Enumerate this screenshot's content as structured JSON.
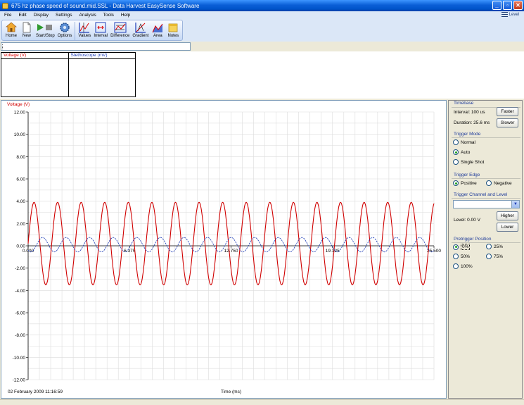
{
  "window": {
    "title": "675 hz phase speed of sound.mid.SSL - Data Harvest EasySense Software",
    "minimize": "_",
    "maximize": "▫",
    "close": "✕"
  },
  "menu": [
    "File",
    "Edit",
    "Display",
    "Settings",
    "Analysis",
    "Tools",
    "Help"
  ],
  "level_button": {
    "label": "Level",
    "icon": "menu-bars-icon"
  },
  "toolbar": [
    {
      "label": "Home",
      "icon": "home-icon"
    },
    {
      "label": "New",
      "icon": "new-document-icon"
    },
    {
      "label": "Start/Stop",
      "icon": "play-stop-icon"
    },
    {
      "label": "Options",
      "icon": "gear-icon"
    },
    {
      "label": "Values",
      "icon": "values-icon"
    },
    {
      "label": "Interval",
      "icon": "interval-icon"
    },
    {
      "label": "Difference",
      "icon": "difference-icon"
    },
    {
      "label": "Gradient",
      "icon": "gradient-icon"
    },
    {
      "label": "Area",
      "icon": "area-icon"
    },
    {
      "label": "Notes",
      "icon": "notes-icon"
    }
  ],
  "meters": [
    {
      "label": "Voltage (V)",
      "color": "#d00000"
    },
    {
      "label": "Stethoscope (mV)",
      "color": "#1a3ab5"
    }
  ],
  "graph": {
    "date": "02 February 2009  11:16:59",
    "xlabel": "Time (ms)",
    "ylabel": "Voltage (V)"
  },
  "chart_data": {
    "type": "line",
    "ylabel": "Voltage (V)",
    "xlabel": "Time (ms)",
    "ylim": [
      -12,
      12
    ],
    "xlim": [
      0,
      25.5
    ],
    "yticks": [
      "12.00",
      "10.00",
      "8.00",
      "6.00",
      "4.00",
      "2.00",
      "0.00",
      "-2.00",
      "-4.00",
      "-6.00",
      "-8.00",
      "-10.00",
      "-12.00"
    ],
    "xticks": [
      "0.000",
      "6.375",
      "12.750",
      "19.125",
      "25.500"
    ],
    "grid": true,
    "series": [
      {
        "name": "Voltage (V)",
        "color": "#d00000",
        "amplitude": 3.7,
        "frequency_khz": 0.675,
        "phase_deg": 0,
        "offset": 0.2
      },
      {
        "name": "Stethoscope (mV)",
        "color": "#1a3ab5",
        "amplitude": 0.65,
        "frequency_khz": 0.675,
        "phase_deg": 230,
        "offset": 0.1
      }
    ]
  },
  "side_panel": {
    "timebase": {
      "title": "Timebase",
      "interval": "Interval: 100 us",
      "duration": "Duration: 25.6 ms",
      "faster": "Faster",
      "slower": "Slower"
    },
    "trigger_mode": {
      "title": "Trigger Mode",
      "options": [
        "Normal",
        "Auto",
        "Single Shot"
      ],
      "selected": "Auto"
    },
    "trigger_edge": {
      "title": "Trigger Edge",
      "options": [
        "Positive",
        "Negative"
      ],
      "selected": "Positive"
    },
    "trigger_channel": {
      "title": "Trigger Channel and Level",
      "selected": "",
      "level": "Level: 0.00 V",
      "higher": "Higher",
      "lower": "Lower"
    },
    "pretrigger": {
      "title": "Pretrigger Position",
      "options": [
        "0%",
        "25%",
        "50%",
        "75%",
        "100%"
      ],
      "selected": "0%"
    }
  }
}
